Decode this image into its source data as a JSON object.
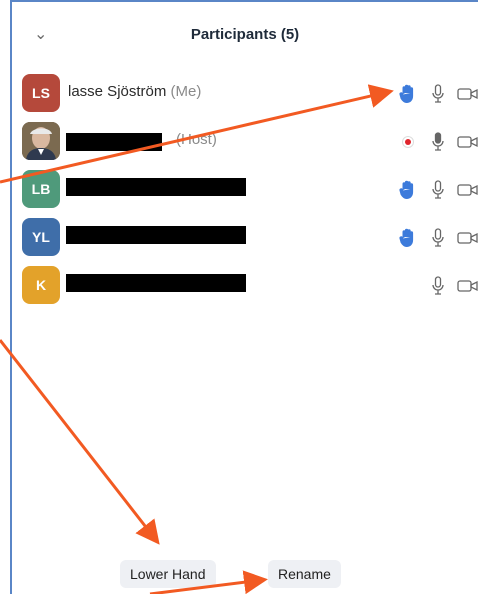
{
  "header": {
    "title": "Participants (5)"
  },
  "participants": [
    {
      "initials": "LS",
      "name": "lasse Sjöström",
      "tag": "(Me)",
      "avatar_color": "#b5493b",
      "hand": true,
      "recording": false
    },
    {
      "initials": "",
      "name": "",
      "tag": "(Host)",
      "avatar_color": "#6c5a40",
      "hand": false,
      "recording": true
    },
    {
      "initials": "LB",
      "name": "",
      "tag": "",
      "avatar_color": "#4f9a7b",
      "hand": true,
      "recording": false
    },
    {
      "initials": "YL",
      "name": "",
      "tag": "",
      "avatar_color": "#3f6ea9",
      "hand": true,
      "recording": false
    },
    {
      "initials": "K",
      "name": "",
      "tag": "",
      "avatar_color": "#e3a22a",
      "hand": false,
      "recording": false
    }
  ],
  "footer": {
    "lower_hand_label": "Lower Hand",
    "rename_label": "Rename"
  },
  "colors": {
    "accent": "#3d7bdb",
    "arrow": "#f25a22",
    "border": "#5a86c7"
  }
}
